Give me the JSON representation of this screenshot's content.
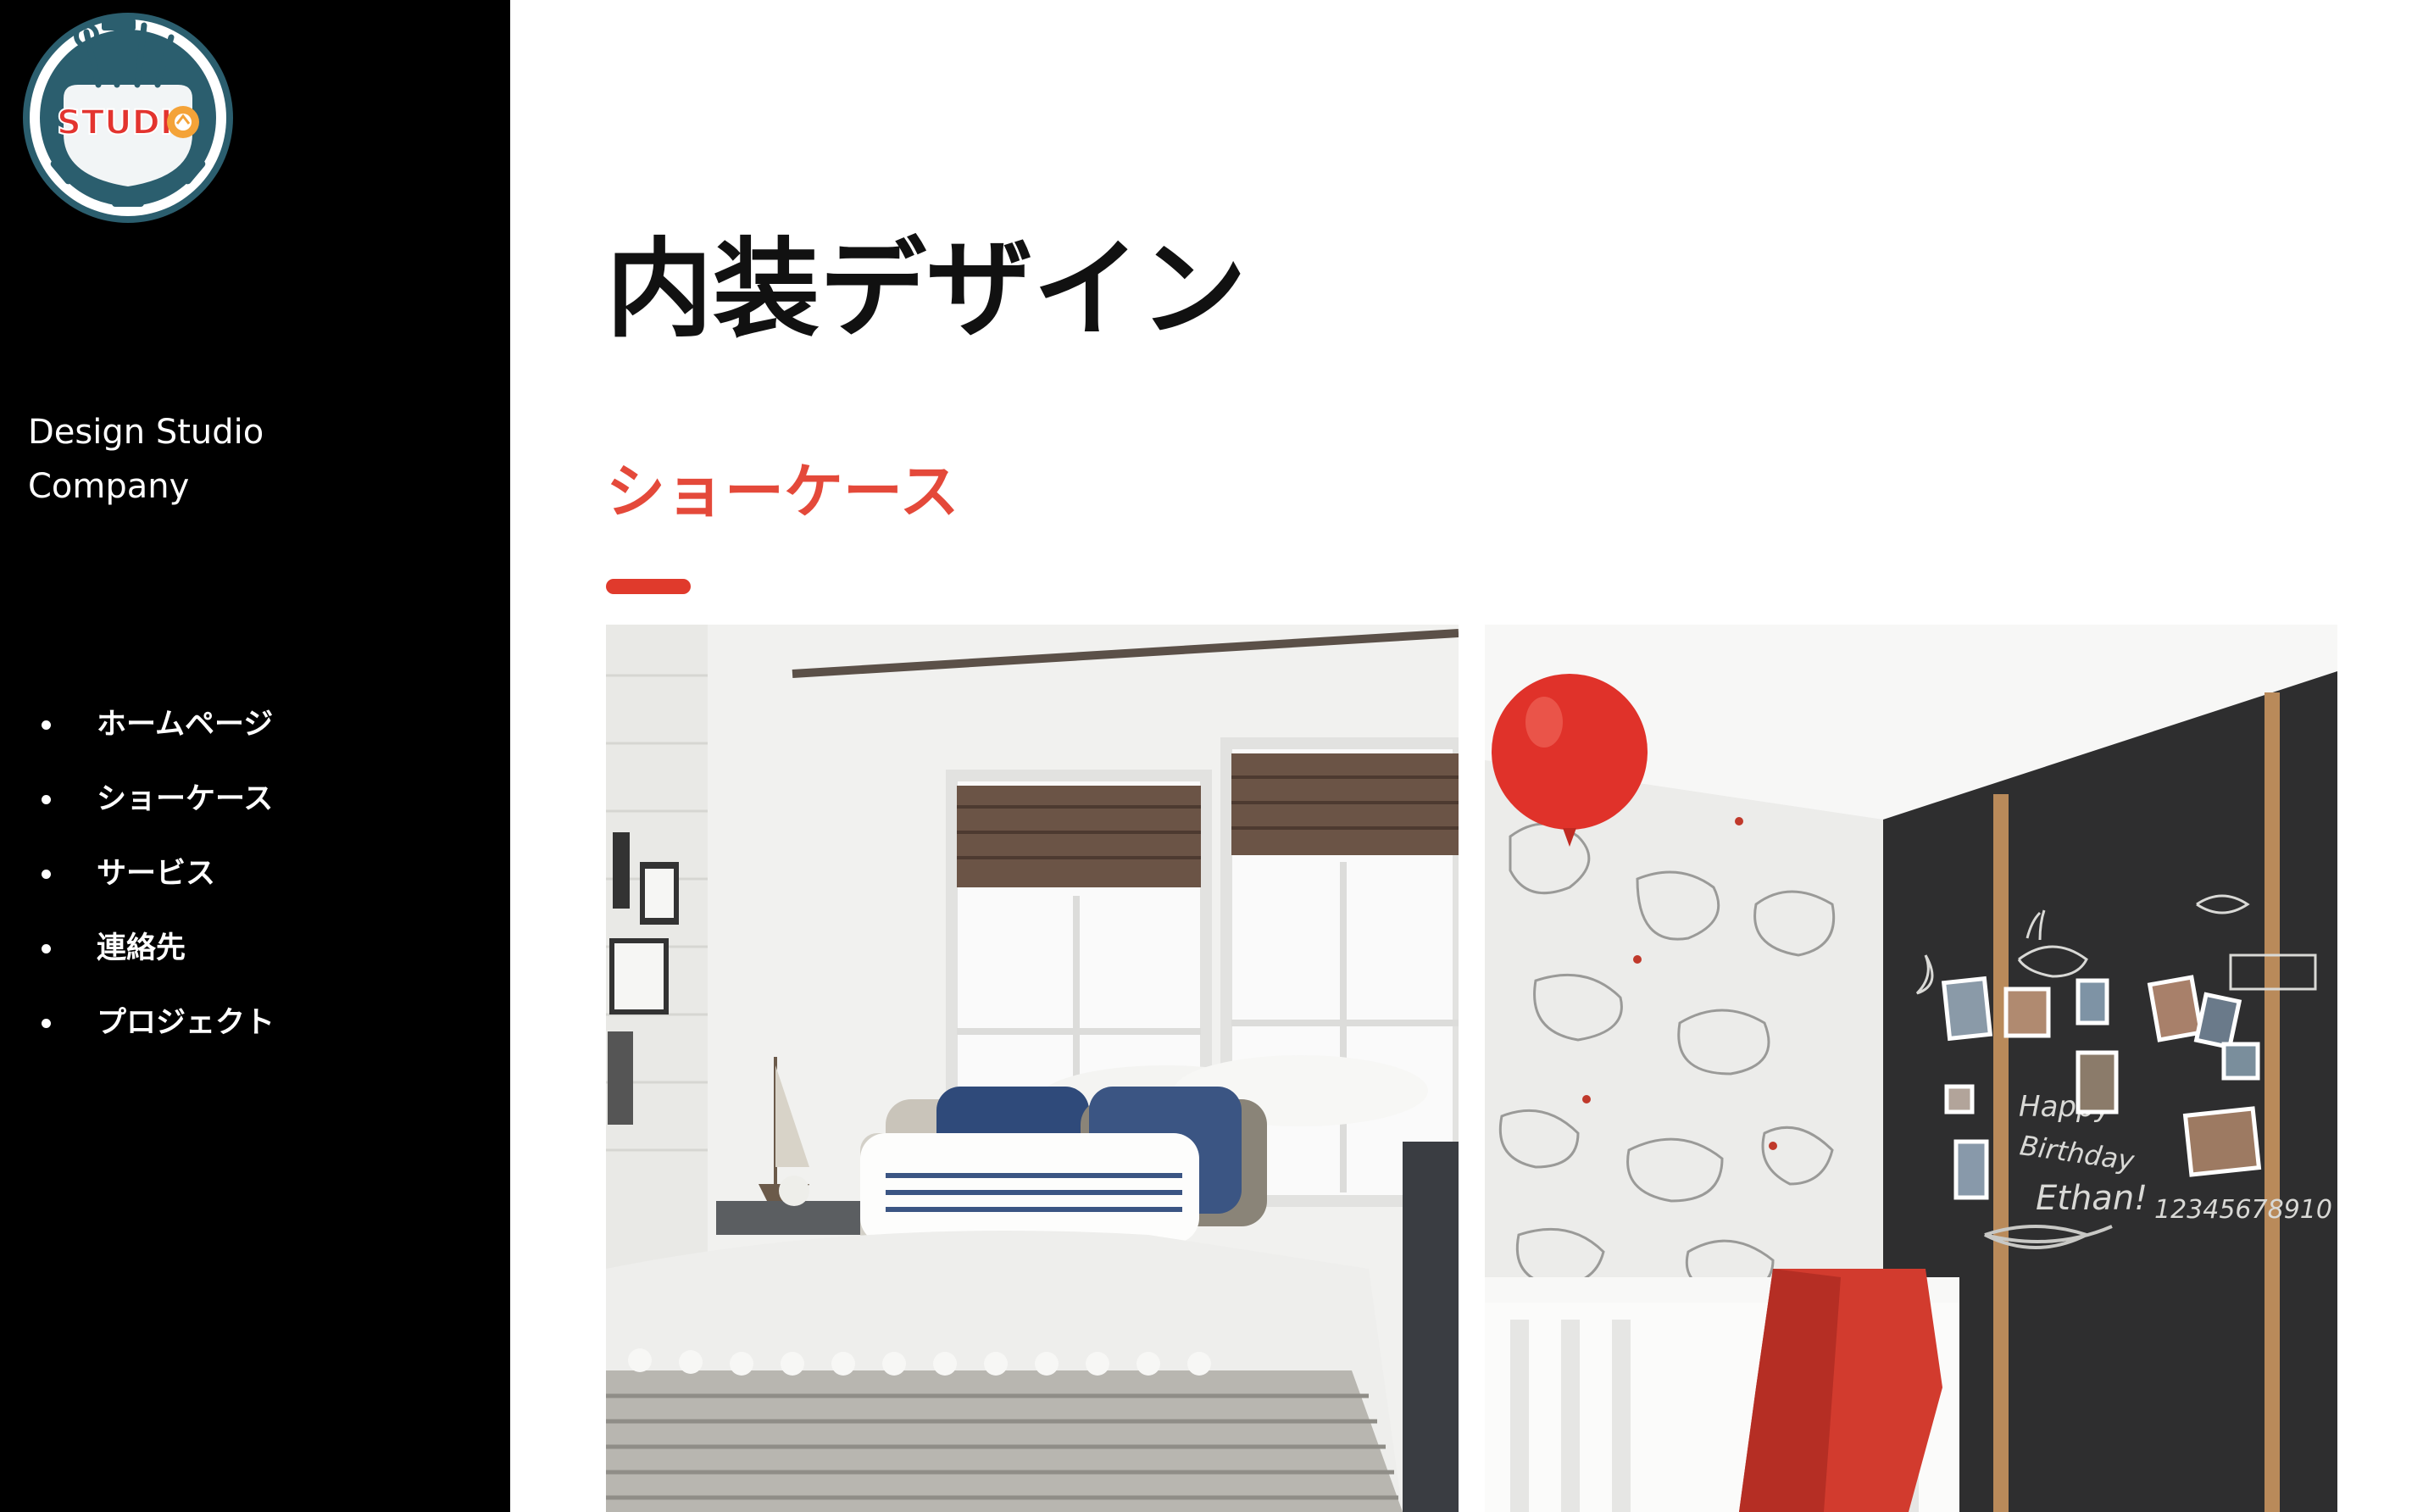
{
  "brand": {
    "logo_text": "STUDI",
    "logo_icon": "gear-tools-logo",
    "company_name": "Design Studio Company"
  },
  "nav": {
    "items": [
      {
        "label": "ホームページ"
      },
      {
        "label": "ショーケース"
      },
      {
        "label": "サービス"
      },
      {
        "label": "連絡先"
      },
      {
        "label": "プロジェクト"
      }
    ]
  },
  "main": {
    "page_title": "内装デザイン",
    "section_title": "ショーケース",
    "photos": [
      {
        "subject": "bedroom-photo"
      },
      {
        "subject": "nursery-chalkboard-photo"
      }
    ],
    "photo2_chalk_text": {
      "line1": "Happy",
      "line2": "Birthday",
      "line3": "Ethan!",
      "numbers": "12345678910"
    }
  },
  "colors": {
    "sidebar_bg": "#000000",
    "accent": "#e4493a",
    "logo_ring": "#2b5e6e"
  }
}
